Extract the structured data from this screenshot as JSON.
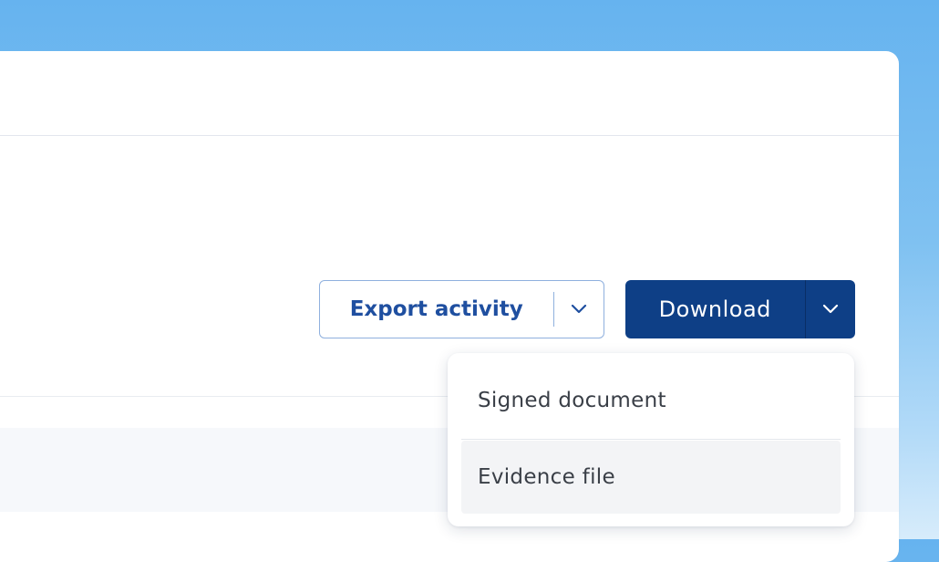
{
  "actions": {
    "export_label": "Export activity",
    "download_label": "Download"
  },
  "download_menu": {
    "items": [
      {
        "label": "Signed document"
      },
      {
        "label": "Evidence file"
      }
    ]
  },
  "icons": {
    "export_caret": "chevron-down-icon",
    "download_caret": "chevron-down-icon"
  },
  "colors": {
    "primary": "#0e3f86",
    "outline": "#8fb0de",
    "export_text": "#1f4fa0",
    "background_gradient_top": "#66b3ef"
  }
}
